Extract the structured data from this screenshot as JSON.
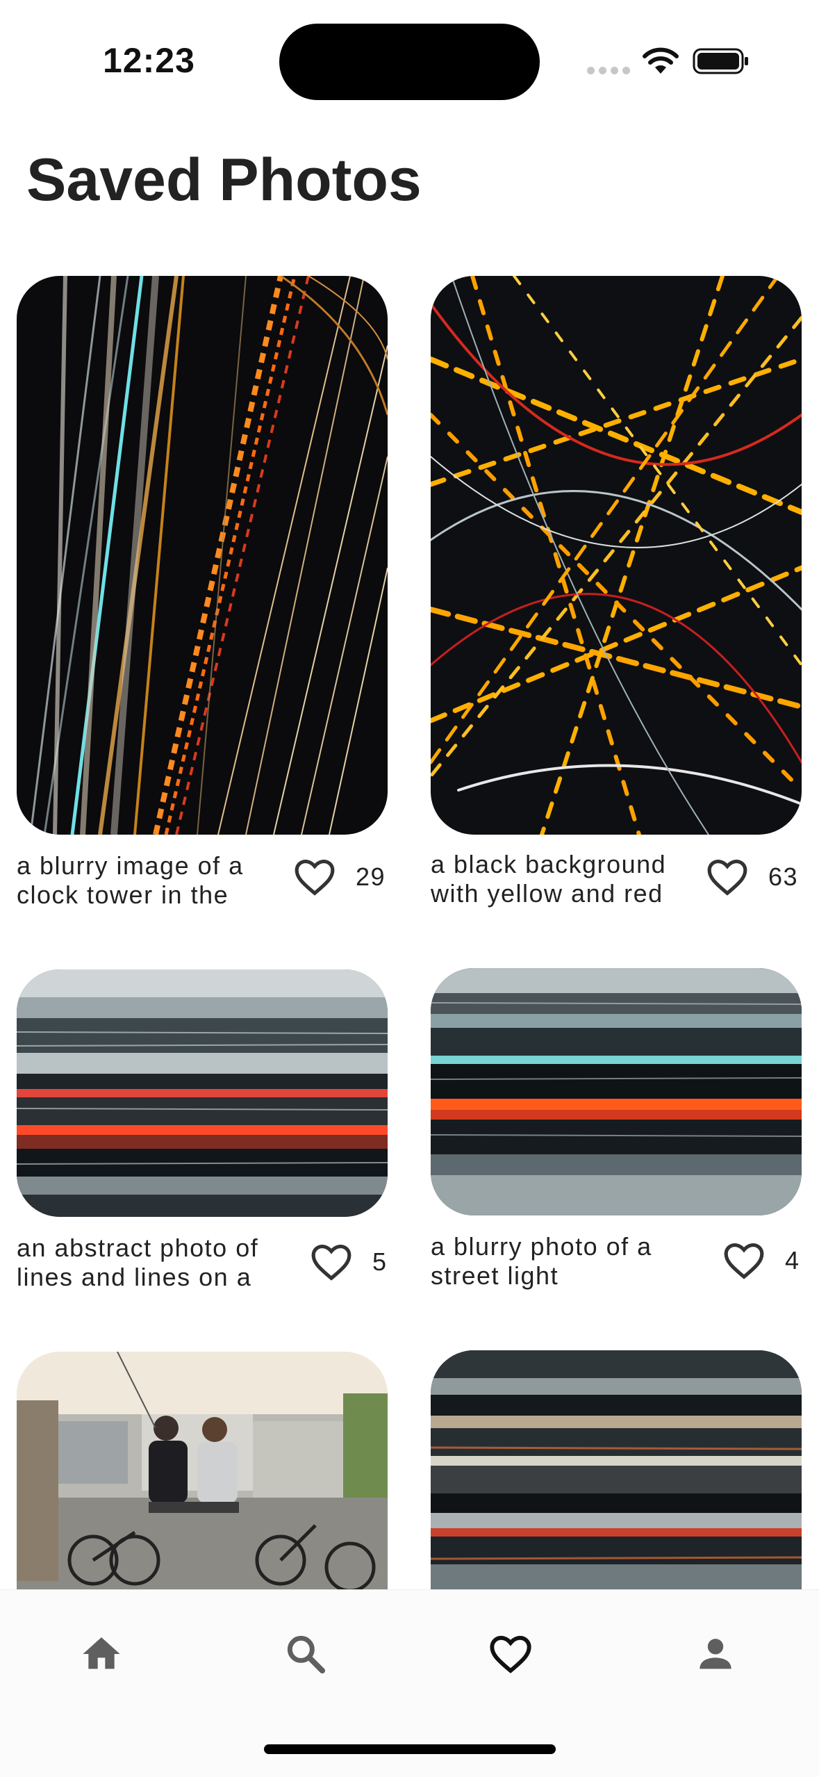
{
  "status_bar": {
    "time": "12:23"
  },
  "page": {
    "title": "Saved Photos"
  },
  "photos": [
    {
      "caption": "a blurry image of a clock tower in the",
      "likes": "29"
    },
    {
      "caption": "a black background with yellow and red",
      "likes": "63"
    },
    {
      "caption": "an abstract photo of lines and lines on a",
      "likes": "5"
    },
    {
      "caption": "a blurry photo of a street light",
      "likes": "4"
    }
  ],
  "bottom_nav": {
    "items": [
      {
        "icon": "home-icon",
        "active": false
      },
      {
        "icon": "search-icon",
        "active": false
      },
      {
        "icon": "heart-icon",
        "active": true
      },
      {
        "icon": "person-icon",
        "active": false
      }
    ]
  },
  "colors": {
    "text": "#222222",
    "icon_inactive": "#5f5f5f",
    "icon_active": "#111111",
    "background": "#ffffff"
  }
}
